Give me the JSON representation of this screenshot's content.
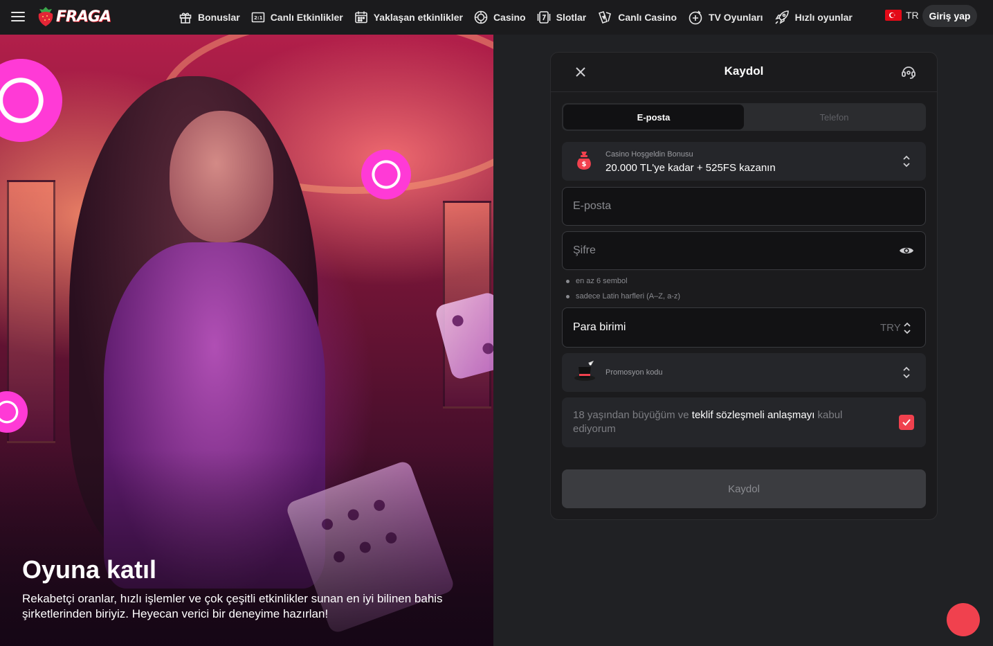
{
  "header": {
    "logo_text": "FRAGA",
    "nav": [
      {
        "label": "Bonuslar",
        "icon": "gift-icon"
      },
      {
        "label": "Canlı Etkinlikler",
        "icon": "live-score-icon"
      },
      {
        "label": "Yaklaşan etkinlikler",
        "icon": "calendar-icon"
      },
      {
        "label": "Casino",
        "icon": "casino-chip-icon"
      },
      {
        "label": "Slotlar",
        "icon": "slot-seven-icon"
      },
      {
        "label": "Canlı Casino",
        "icon": "live-casino-icon"
      },
      {
        "label": "TV Oyunları",
        "icon": "tv-games-icon"
      },
      {
        "label": "Hızlı oyunlar",
        "icon": "rocket-icon"
      }
    ],
    "language": "TR",
    "login_label": "Giriş yap"
  },
  "hero": {
    "title": "Oyuna katıl",
    "text": "Rekabetçi oranlar, hızlı işlemler ve çok çeşitli etkinlikler sunan en iyi bilinen bahis şirketlerinden biriyiz. Heyecan verici bir deneyime hazırlan!"
  },
  "register": {
    "title": "Kaydol",
    "tabs": {
      "email": "E-posta",
      "phone": "Telefon"
    },
    "bonus": {
      "label": "Casino Hoşgeldin Bonusu",
      "value": "20.000 TL'ye kadar + 525FS kazanın"
    },
    "email_placeholder": "E-posta",
    "password_placeholder": "Şifre",
    "password_hints": [
      "en az 6 sembol",
      "sadece Latin harfleri (A–Z, a-z)"
    ],
    "currency": {
      "label": "Para birimi",
      "value": "TRY"
    },
    "promo_label": "Promosyon kodu",
    "terms": {
      "pre": "18 yaşından büyüğüm ve ",
      "link": "teklif sözleşmeli anlaşmayı",
      "post": " kabul ediyorum",
      "checked": true
    },
    "submit_label": "Kaydol"
  },
  "colors": {
    "accent": "#f0414e",
    "background": "#202124",
    "panel": "#1b1b1d"
  }
}
